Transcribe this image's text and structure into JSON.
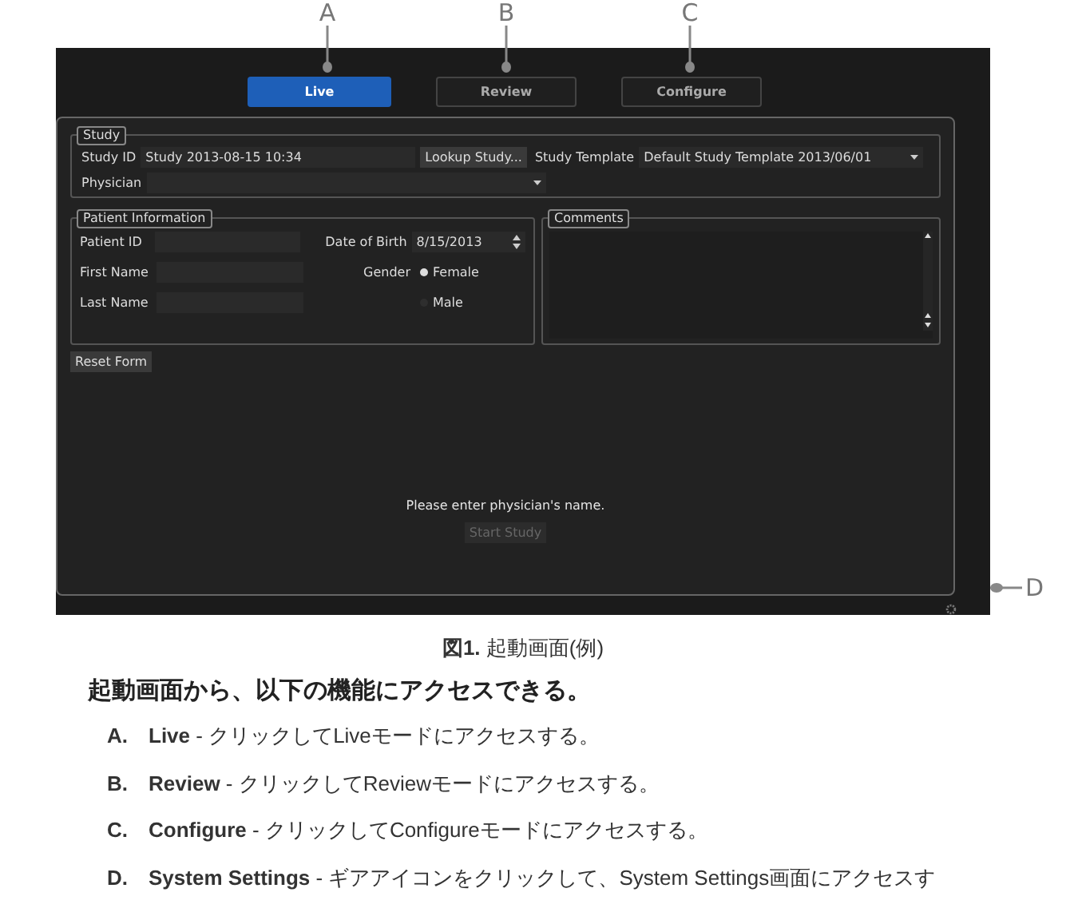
{
  "callouts": [
    "A",
    "B",
    "C"
  ],
  "tabs": [
    {
      "label": "Live",
      "selected": true
    },
    {
      "label": "Review",
      "selected": false
    },
    {
      "label": "Configure",
      "selected": false
    }
  ],
  "study": {
    "legend": "Study",
    "study_id_label": "Study ID",
    "study_id_value": "Study 2013-08-15 10:34",
    "lookup_button": "Lookup Study...",
    "template_label": "Study Template",
    "template_value": "Default Study Template 2013/06/01",
    "physician_label": "Physician"
  },
  "patient": {
    "legend": "Patient Information",
    "patient_id_label": "Patient ID",
    "dob_label": "Date of Birth",
    "dob_value": "8/15/2013",
    "first_name_label": "First Name",
    "gender_label": "Gender",
    "last_name_label": "Last Name",
    "genders": [
      {
        "label": "Female",
        "selected": true
      },
      {
        "label": "Male",
        "selected": false
      }
    ]
  },
  "comments": {
    "legend": "Comments"
  },
  "reset_button": "Reset Form",
  "message": "Please enter physician's name.",
  "start_button": {
    "label": "Start Study",
    "disabled": true
  },
  "settings_callout": "D",
  "caption": "**図1.** 起動画面(例)",
  "intro": "起動画面から、以下の機能にアクセスできる。",
  "items": [
    {
      "letter": "A.",
      "text": "**Live** - クリックしてLiveモードにアクセスする。"
    },
    {
      "letter": "B.",
      "text": "**Review** - クリックしてReviewモードにアクセスする。"
    },
    {
      "letter": "C.",
      "text": "**Configure** - クリックしてConfigureモードにアクセスする。"
    },
    {
      "letter": "D.",
      "text": "**System Settings** - ギアアイコンをクリックして、System Settings画面にアクセスす"
    }
  ]
}
